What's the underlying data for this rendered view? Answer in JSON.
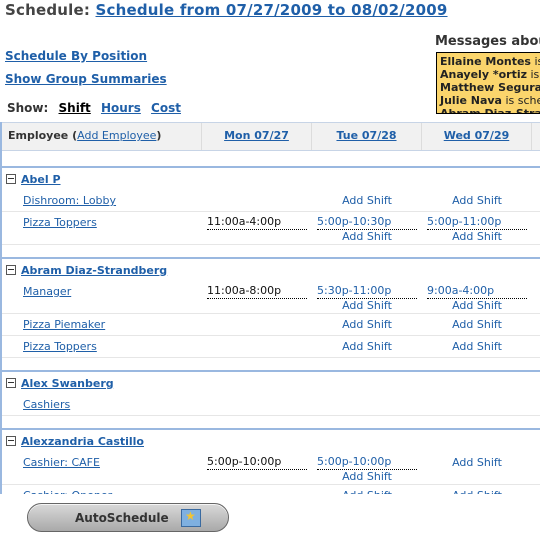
{
  "header": {
    "label": "Schedule:",
    "schedule_link": "Schedule from 07/27/2009 to 08/02/2009"
  },
  "side_links": [
    "Schedule By Position",
    "Show Group Summaries"
  ],
  "show": {
    "label": "Show:",
    "options": [
      {
        "label": "Shift",
        "active": true
      },
      {
        "label": "Hours",
        "active": false
      },
      {
        "label": "Cost",
        "active": false
      }
    ]
  },
  "messages": {
    "title": "Messages about",
    "items": [
      {
        "name": "Ellaine Montes",
        "text": " is s"
      },
      {
        "name": "Anayely *ortiz",
        "text": " is s"
      },
      {
        "name": "Matthew Segura",
        "text": " is"
      },
      {
        "name": "Julie Nava",
        "text": " is sched"
      },
      {
        "name": "Abram Diaz-Stran",
        "text": ""
      }
    ]
  },
  "table": {
    "employee_header": "Employee",
    "add_employee": "Add Employee",
    "days": [
      "Mon 07/27",
      "Tue 07/28",
      "Wed 07/29"
    ],
    "add_shift_label": "Add Shift",
    "groups": [
      {
        "name": "Abel P",
        "rows": [
          {
            "position": "Dishroom: Lobby",
            "cells": [
              {
                "shift": "",
                "add": false
              },
              {
                "shift": "",
                "add": true
              },
              {
                "shift": "",
                "add": true
              }
            ]
          },
          {
            "position": "Pizza Toppers",
            "cells": [
              {
                "shift": "11:00a-4:00p",
                "link": false,
                "add": false
              },
              {
                "shift": "5:00p-10:30p",
                "link": true,
                "add": true
              },
              {
                "shift": "5:00p-11:00p",
                "link": true,
                "add": true
              }
            ]
          }
        ]
      },
      {
        "name": "Abram Diaz-Strandberg",
        "rows": [
          {
            "position": "Manager",
            "cells": [
              {
                "shift": "11:00a-8:00p",
                "link": false,
                "add": false
              },
              {
                "shift": "5:30p-11:00p",
                "link": true,
                "add": true
              },
              {
                "shift": "9:00a-4:00p",
                "link": true,
                "add": true
              }
            ]
          },
          {
            "position": "Pizza Piemaker",
            "cells": [
              {
                "shift": "",
                "add": false
              },
              {
                "shift": "",
                "add": true
              },
              {
                "shift": "",
                "add": true
              }
            ]
          },
          {
            "position": "Pizza Toppers",
            "cells": [
              {
                "shift": "",
                "add": false
              },
              {
                "shift": "",
                "add": true
              },
              {
                "shift": "",
                "add": true
              }
            ]
          }
        ]
      },
      {
        "name": "Alex Swanberg",
        "rows": [
          {
            "position": "Cashiers",
            "cells": [
              {
                "shift": "",
                "add": false
              },
              {
                "shift": "",
                "add": false
              },
              {
                "shift": "",
                "add": false
              }
            ]
          }
        ]
      },
      {
        "name": "Alexzandria Castillo",
        "rows": [
          {
            "position": "Cashier: CAFE",
            "cells": [
              {
                "shift": "5:00p-10:00p",
                "link": false,
                "add": false
              },
              {
                "shift": "5:00p-10:00p",
                "link": true,
                "add": true
              },
              {
                "shift": "",
                "add": true
              }
            ]
          },
          {
            "position": "Cashier: Opener",
            "cells": [
              {
                "shift": "",
                "add": false
              },
              {
                "shift": "",
                "add": true
              },
              {
                "shift": "",
                "add": true
              }
            ]
          }
        ]
      }
    ]
  },
  "autoschedule": {
    "label": "AutoSchedule"
  }
}
